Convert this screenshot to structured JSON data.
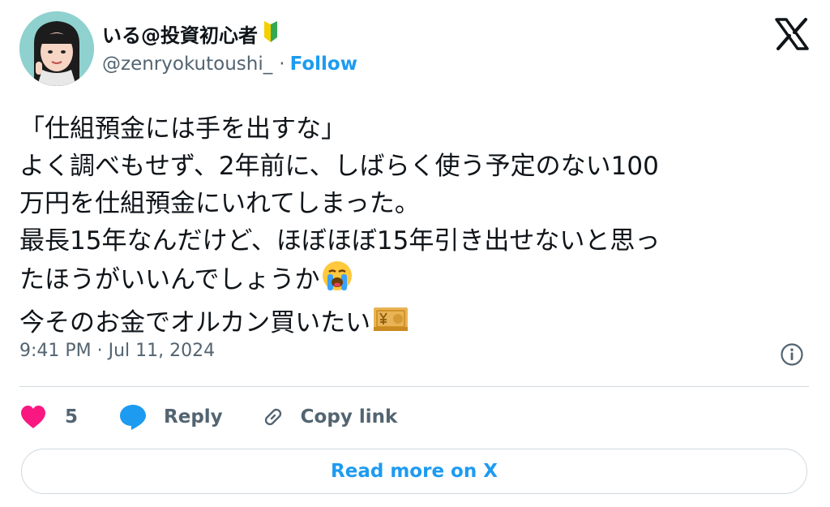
{
  "author": {
    "display_name": "いる@投資初心者",
    "handle": "@zenryokutoushi_",
    "separator": "·",
    "follow_label": "Follow"
  },
  "tweet": {
    "lines": [
      "「仕組預金には手を出すな」",
      "よく調べもせず、2年前に、しばらく使う予定のない100",
      "万円を仕組預金にいれてしまった。",
      "最長15年なんだけど、ほぼほぼ15年引き出せないと思っ",
      "たほうがいいんでしょうか",
      "今そのお金でオルカン買いたい"
    ],
    "emojis": [
      "loudly-crying-face-emoji",
      "yen-banknote-emoji"
    ]
  },
  "meta": {
    "timestamp": "9:41 PM · Jul 11, 2024"
  },
  "actions": {
    "like_count": "5",
    "reply_label": "Reply",
    "copy_link_label": "Copy link"
  },
  "read_more_label": "Read more on X",
  "colors": {
    "accent": "#1d9bf0",
    "heart": "#f91880",
    "text": "#0f1419",
    "secondary": "#536471",
    "border": "#cfd9de"
  },
  "icons": [
    "beginner-mark-icon",
    "x-logo-icon",
    "info-icon",
    "heart-icon",
    "reply-bubble-icon",
    "link-icon"
  ]
}
